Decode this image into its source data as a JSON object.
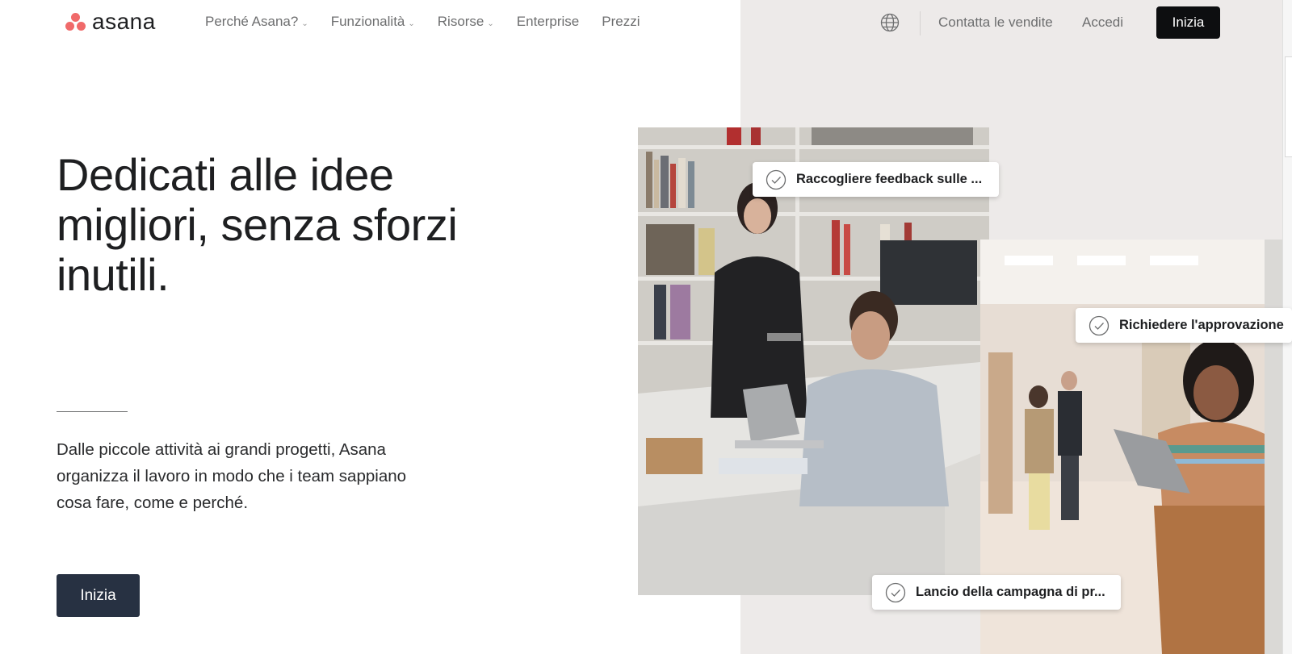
{
  "header": {
    "logo_text": "asana",
    "nav": [
      {
        "label": "Perché Asana?",
        "has_dropdown": true
      },
      {
        "label": "Funzionalità",
        "has_dropdown": true
      },
      {
        "label": "Risorse",
        "has_dropdown": true
      },
      {
        "label": "Enterprise",
        "has_dropdown": false
      },
      {
        "label": "Prezzi",
        "has_dropdown": false
      }
    ],
    "language_icon": "globe-icon",
    "contact_label": "Contatta le vendite",
    "login_label": "Accedi",
    "cta_label": "Inizia"
  },
  "hero": {
    "title_lines": [
      "Dedicati alle idee",
      "migliori, senza sforzi",
      "inutili."
    ],
    "subtitle": "Dalle piccole attività ai grandi progetti, Asana organizza il lavoro in modo che i team sappiano cosa fare, come e perché.",
    "cta_label": "Inizia"
  },
  "task_cards": [
    {
      "label": "Raccogliere feedback sulle ...",
      "icon": "check-circle-icon"
    },
    {
      "label": "Richiedere l'approvazione",
      "icon": "check-circle-icon"
    },
    {
      "label": "Lancio della campagna di pr...",
      "icon": "check-circle-icon"
    }
  ],
  "colors": {
    "brand_coral": "#f06a6a",
    "right_panel_bg": "#edeae9",
    "top_cta_bg": "#0d0e10",
    "hero_cta_bg": "#273142",
    "nav_text": "#6d6e6f"
  }
}
